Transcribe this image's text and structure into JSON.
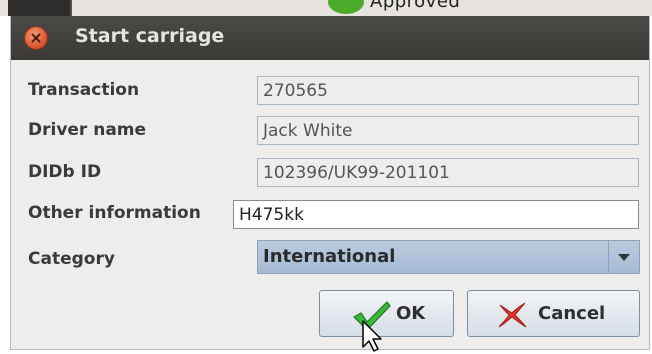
{
  "background": {
    "partial_text": "Approved",
    "green_icon": "green-circle-icon"
  },
  "dialog": {
    "title": "Start carriage",
    "close_icon": "close-icon",
    "fields": {
      "transaction": {
        "label": "Transaction",
        "value": "270565"
      },
      "driver_name": {
        "label": "Driver name",
        "value": "Jack White"
      },
      "didb_id": {
        "label": "DIDb ID",
        "value": "102396/UK99-201101"
      },
      "other_information": {
        "label": "Other information",
        "value": "H475kk"
      },
      "category": {
        "label": "Category",
        "selected": "International"
      }
    },
    "buttons": {
      "ok": {
        "label": "OK",
        "icon": "green-checkmark-icon"
      },
      "cancel": {
        "label": "Cancel",
        "icon": "red-x-icon"
      }
    }
  },
  "colors": {
    "titlebar": "#3f3e3a",
    "select_bg": "#afc2d9",
    "ok_check": "#3bb53a",
    "cancel_x": "#e0372a"
  }
}
